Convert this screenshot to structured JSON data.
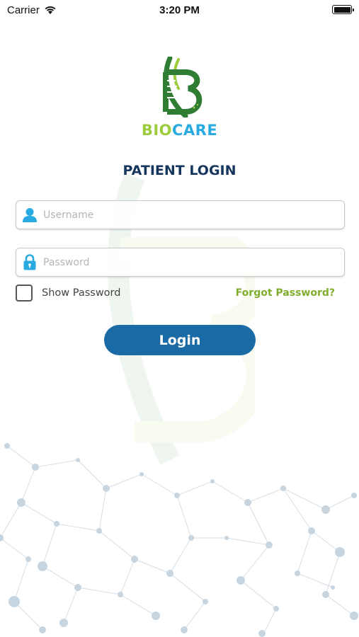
{
  "status_bar": {
    "carrier": "Carrier",
    "time": "3:20 PM",
    "wifi_icon": "wifi-icon",
    "battery_icon": "battery-icon",
    "battery_level": 1.0
  },
  "logo": {
    "text_part1": "BIO",
    "text_part2": "CARE",
    "colors": {
      "green": "#9ccb3b",
      "blue": "#29abe2",
      "dark_green": "#2e7d32"
    }
  },
  "title": "PATIENT LOGIN",
  "username": {
    "placeholder": "Username",
    "value": "",
    "icon": "user-icon"
  },
  "password": {
    "placeholder": "Password",
    "value": "",
    "icon": "lock-icon"
  },
  "show_password_label": "Show Password",
  "show_password_checked": false,
  "forgot_password_label": "Forgot Password?",
  "login_label": "Login",
  "colors": {
    "title": "#16365e",
    "button": "#1a6aa6",
    "link": "#7fad2d",
    "icon": "#29abe2"
  }
}
